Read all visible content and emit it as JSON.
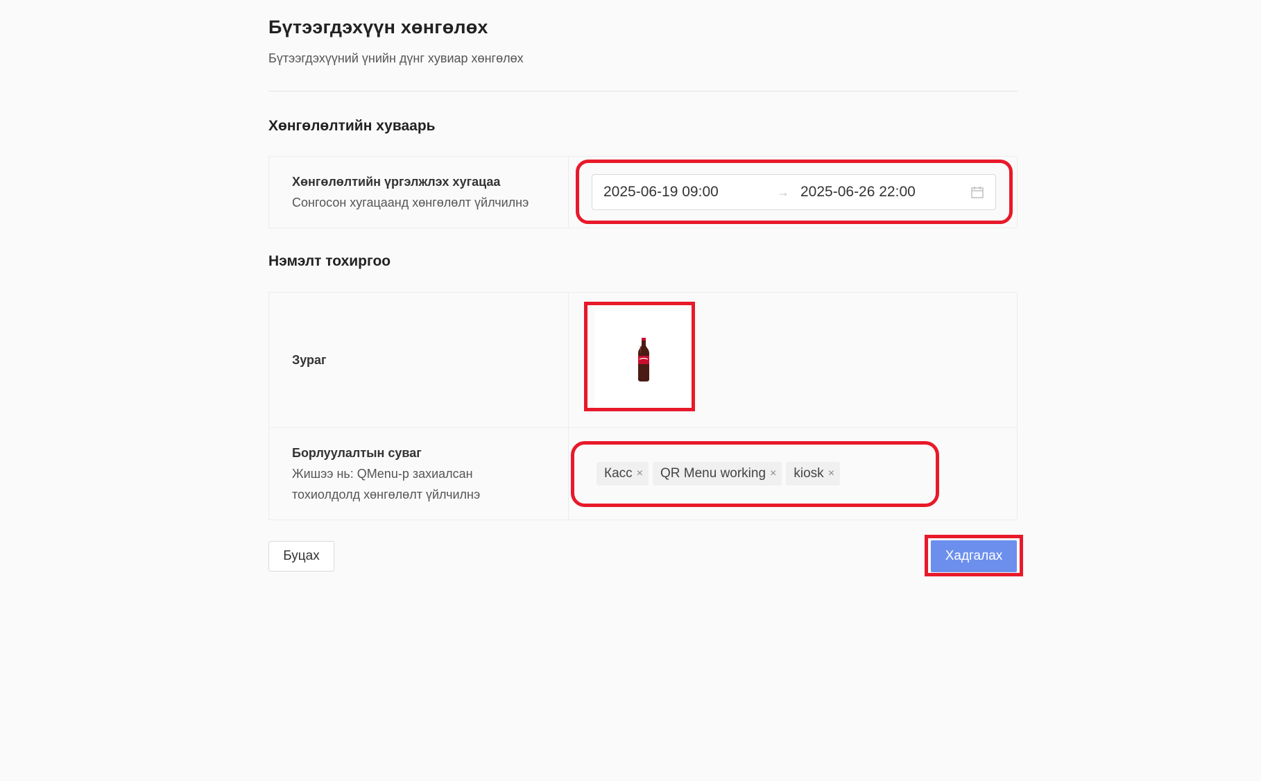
{
  "header": {
    "title": "Бүтээгдэхүүн хөнгөлөх",
    "subtitle": "Бүтээгдэхүүний үнийн дүнг хувиар хөнгөлөх"
  },
  "schedule_section": {
    "title": "Хөнгөлөлтийн хуваарь",
    "duration_label": "Хөнгөлөлтийн үргэлжлэх хугацаа",
    "duration_help": "Сонгосон хугацаанд хөнгөлөлт үйлчилнэ",
    "range_start": "2025-06-19 09:00",
    "range_separator": "→",
    "range_end": "2025-06-26 22:00",
    "calendar_icon": "calendar-icon"
  },
  "extra_section": {
    "title": "Нэмэлт тохиргоо",
    "image_label": "Зураг",
    "image_icon": "cola-bottle-image",
    "channel_label": "Борлуулалтын суваг",
    "channel_help_line1": "Жишээ нь: QMenu-р захиалсан",
    "channel_help_line2": "тохиолдолд хөнгөлөлт үйлчилнэ",
    "channels": [
      {
        "label": "Касс"
      },
      {
        "label": "QR Menu working"
      },
      {
        "label": "kiosk"
      }
    ],
    "tag_close_glyph": "×"
  },
  "actions": {
    "back_label": "Буцах",
    "save_label": "Хадгалах"
  },
  "colors": {
    "primary": "#6c8fee",
    "highlight": "#e8192a"
  }
}
